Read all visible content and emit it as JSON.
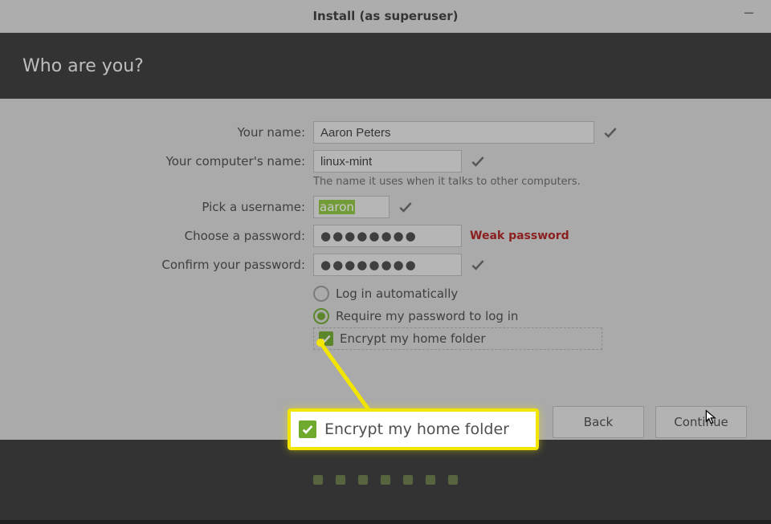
{
  "window": {
    "title": "Install (as superuser)"
  },
  "header": {
    "title": "Who are you?"
  },
  "form": {
    "name_label": "Your name:",
    "name_value": "Aaron Peters",
    "computer_label": "Your computer's name:",
    "computer_value": "linux-mint",
    "computer_help": "The name it uses when it talks to other computers.",
    "username_label": "Pick a username:",
    "username_value": "aaron",
    "password_label": "Choose a password:",
    "password_value": "●●●●●●●●",
    "password_strength": "Weak password",
    "confirm_label": "Confirm your password:",
    "confirm_value": "●●●●●●●●"
  },
  "options": {
    "auto_login_label": "Log in automatically",
    "auto_login_selected": false,
    "require_pw_label": "Require my password to log in",
    "require_pw_selected": true,
    "encrypt_label": "Encrypt my home folder",
    "encrypt_checked": true
  },
  "buttons": {
    "back": "Back",
    "continue": "Continue"
  },
  "callout": {
    "label": "Encrypt my home folder"
  },
  "progress": {
    "dots": 7
  }
}
